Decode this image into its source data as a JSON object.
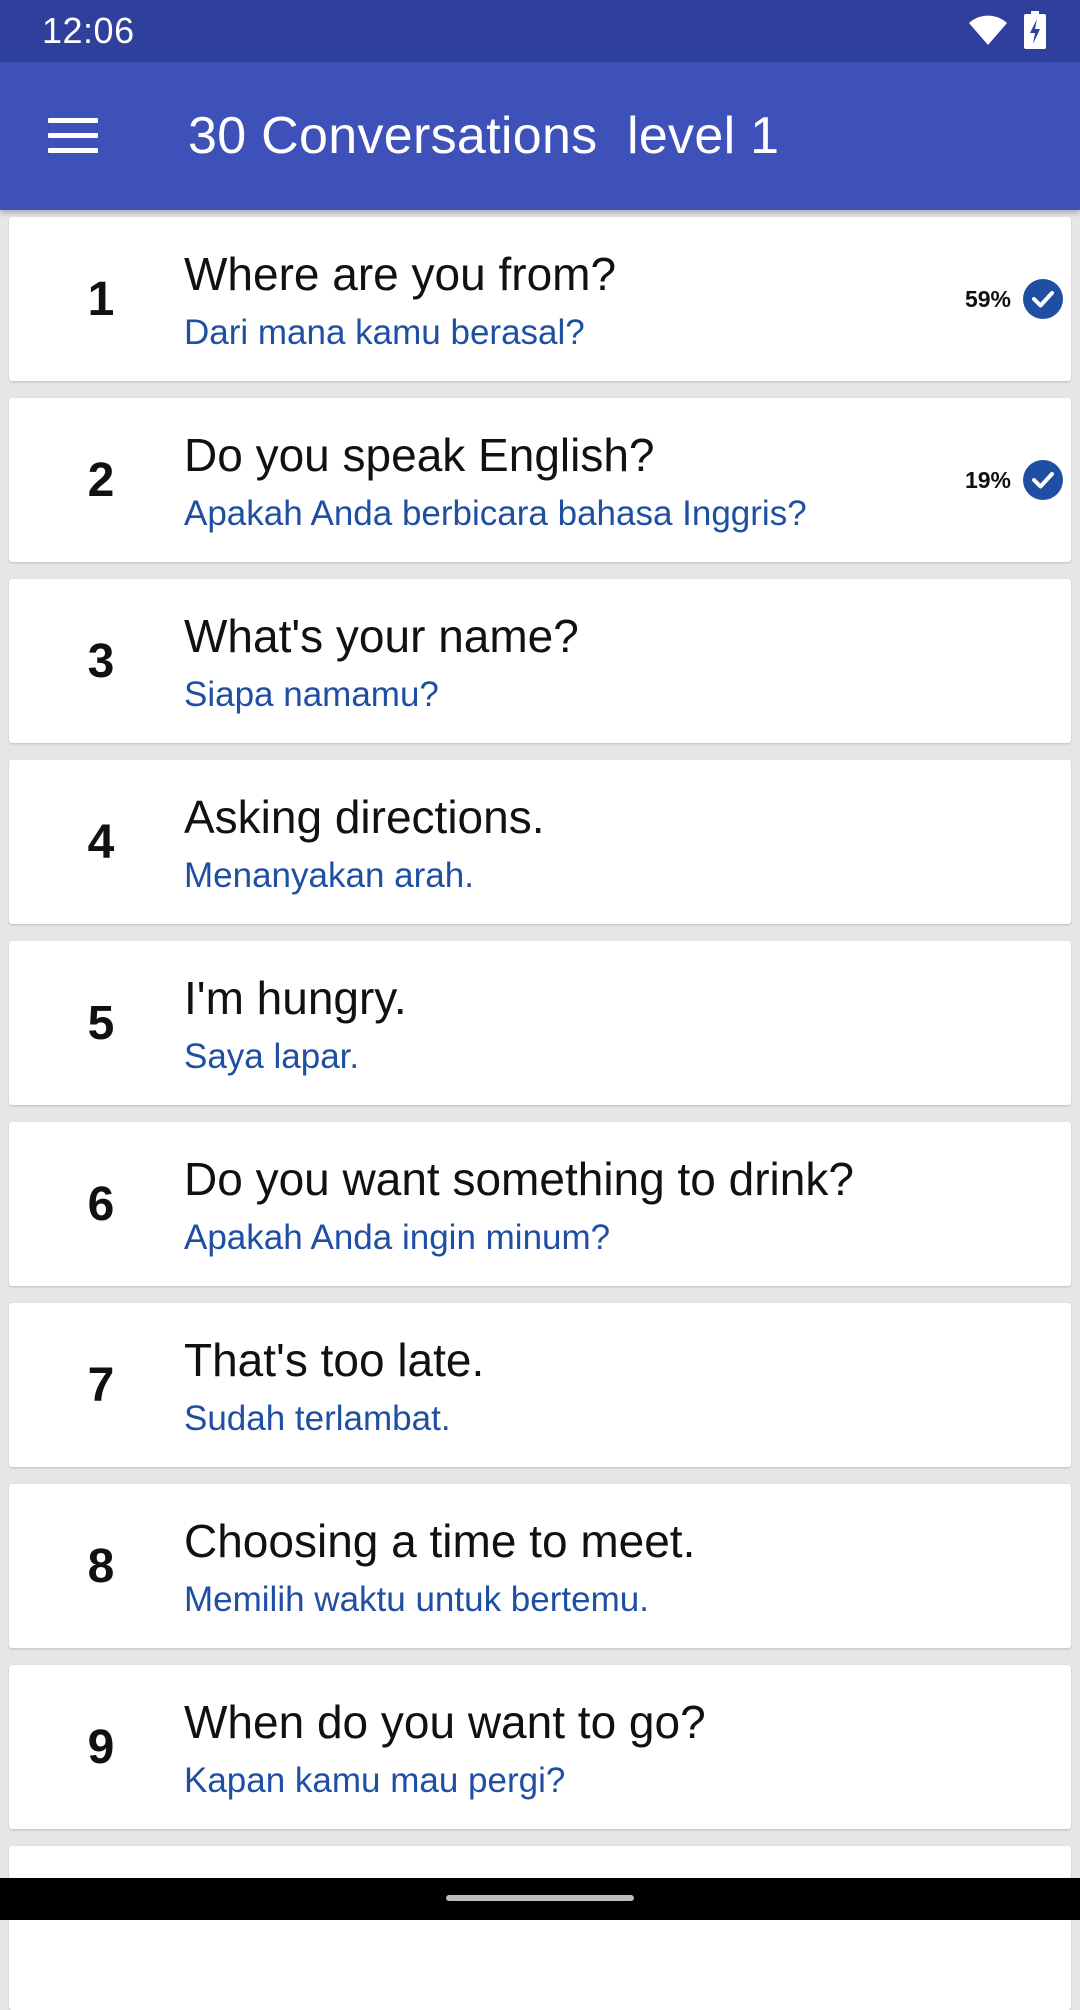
{
  "status": {
    "time": "12:06"
  },
  "app_bar": {
    "title": "30 Conversations  level 1",
    "menu_icon": "hamburger-menu-icon"
  },
  "colors": {
    "app_bar": "#3d51b8",
    "status_bar": "#2e3f9c",
    "accent": "#1f4fa3"
  },
  "items": [
    {
      "number": "1",
      "title": "Where are you from?",
      "subtitle": "Dari mana kamu berasal?",
      "progress": "59%",
      "completed": true
    },
    {
      "number": "2",
      "title": "Do you speak English?",
      "subtitle": "Apakah Anda berbicara bahasa Inggris?",
      "progress": "19%",
      "completed": true
    },
    {
      "number": "3",
      "title": "What's your name?",
      "subtitle": "Siapa namamu?"
    },
    {
      "number": "4",
      "title": "Asking directions.",
      "subtitle": "Menanyakan arah."
    },
    {
      "number": "5",
      "title": "I'm hungry.",
      "subtitle": "Saya lapar."
    },
    {
      "number": "6",
      "title": "Do you want something to drink?",
      "subtitle": "Apakah Anda ingin minum?"
    },
    {
      "number": "7",
      "title": "That's too late.",
      "subtitle": "Sudah terlambat."
    },
    {
      "number": "8",
      "title": "Choosing a time to meet.",
      "subtitle": "Memilih waktu untuk bertemu."
    },
    {
      "number": "9",
      "title": "When do you want to go?",
      "subtitle": "Kapan kamu mau pergi?"
    }
  ]
}
